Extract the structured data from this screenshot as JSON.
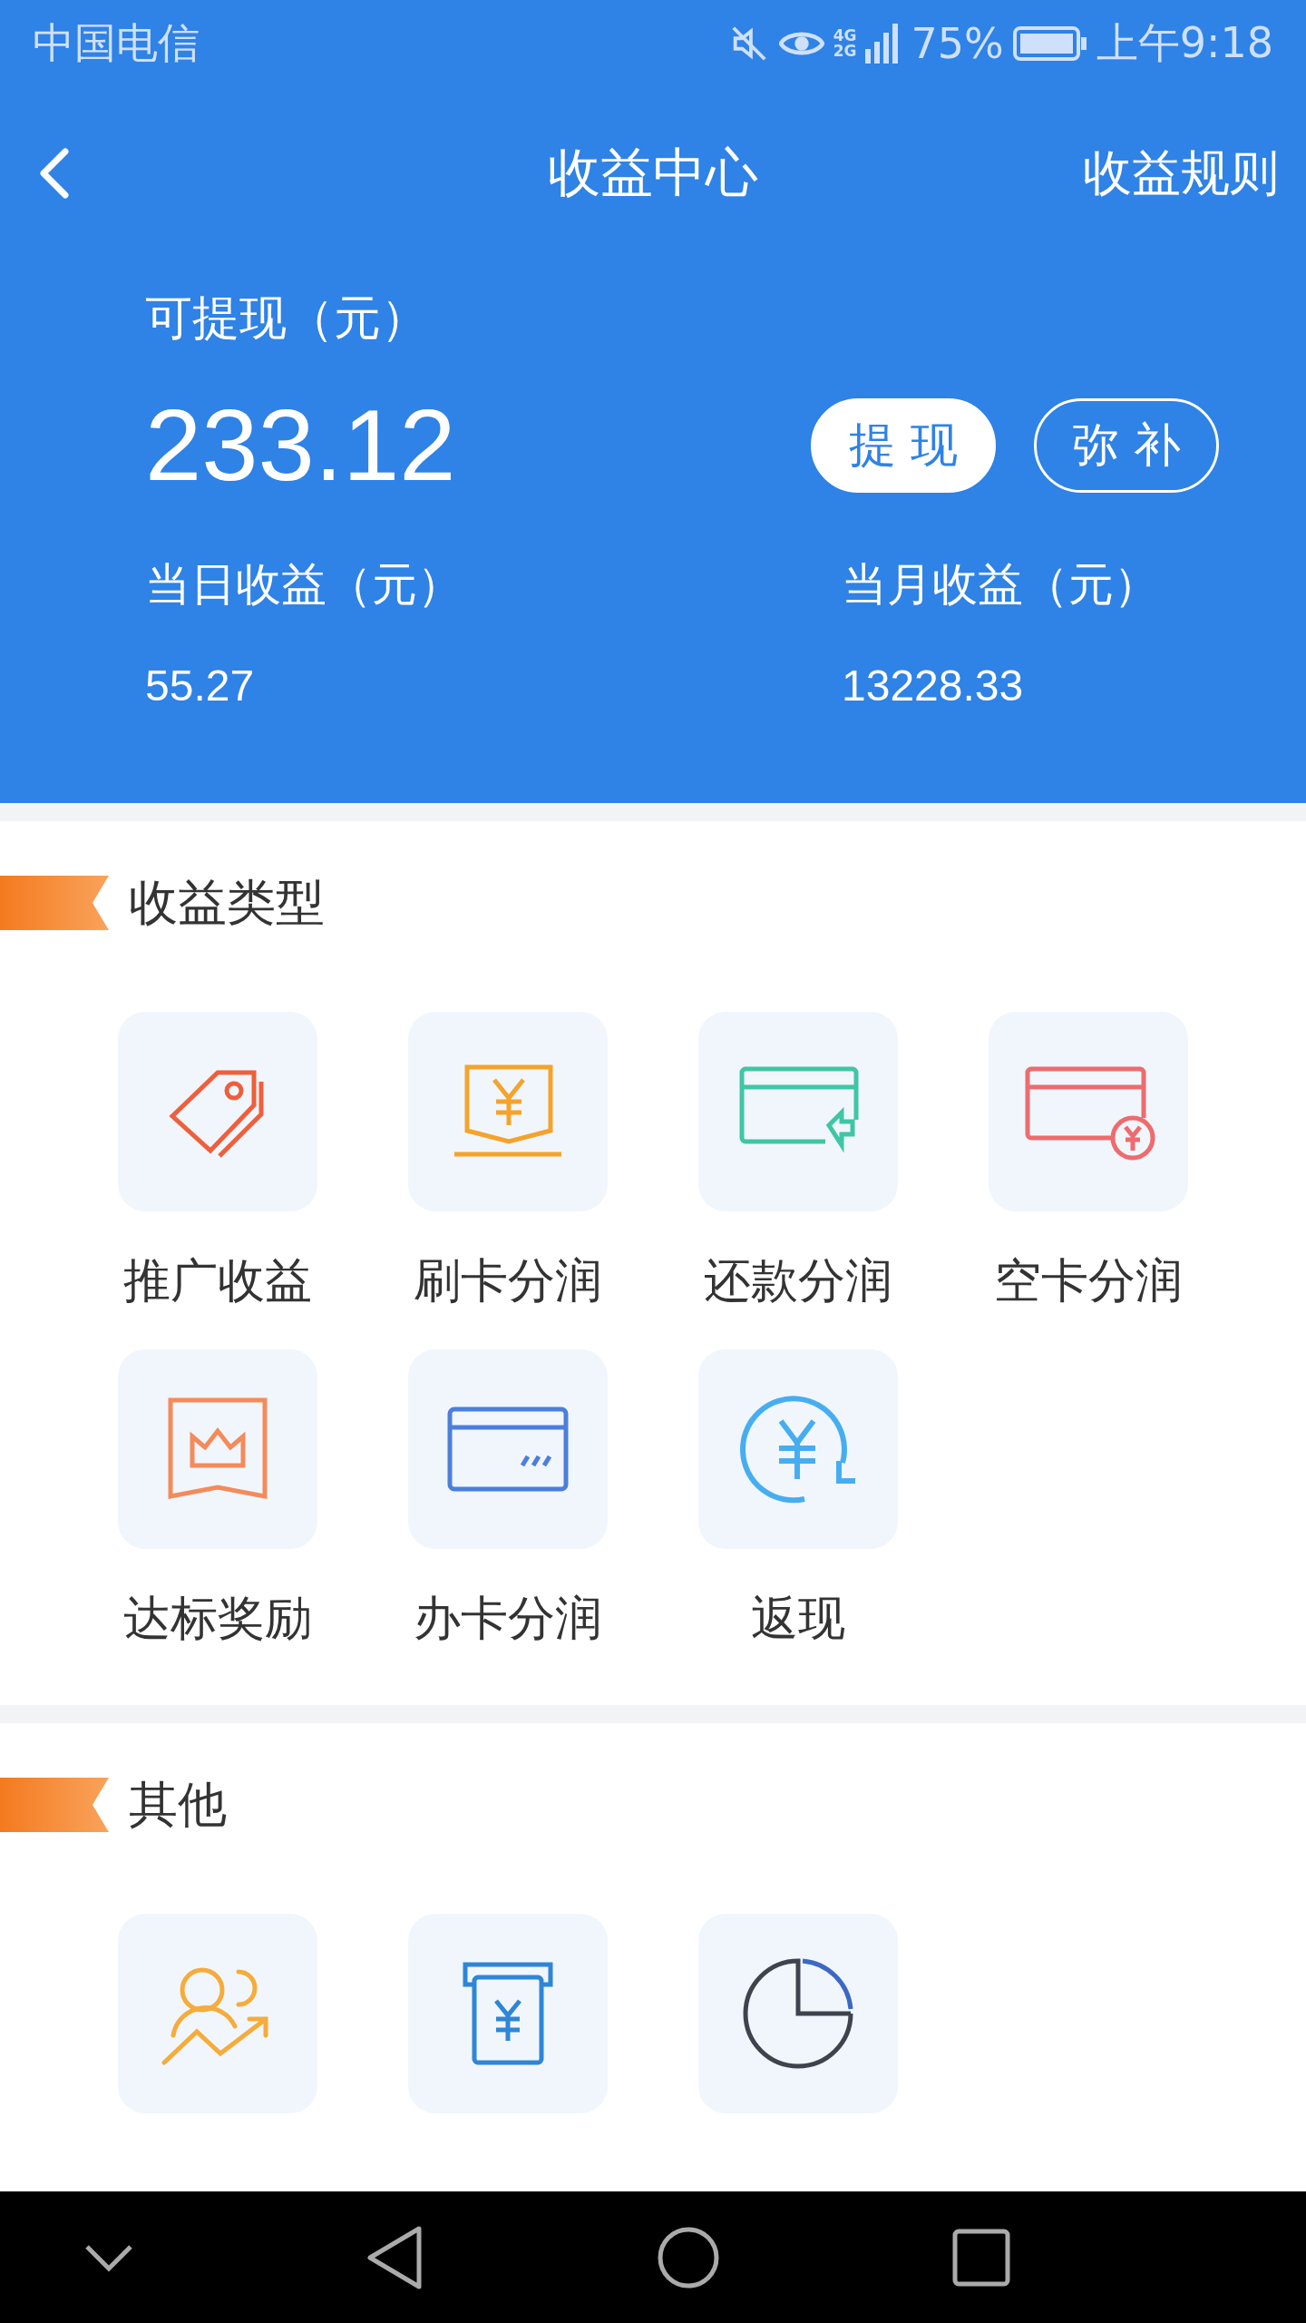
{
  "status_bar": {
    "carrier": "中国电信",
    "network_top": "4G",
    "network_bottom": "2G",
    "battery": "75%",
    "time": "上午9:18"
  },
  "header": {
    "title": "收益中心",
    "rules_link": "收益规则"
  },
  "balance": {
    "label": "可提现（元）",
    "amount": "233.12",
    "buttons": [
      "提 现",
      "弥 补"
    ],
    "stats": [
      {
        "label": "当日收益（元）",
        "value": "55.27"
      },
      {
        "label": "当月收益（元）",
        "value": "13228.33"
      }
    ]
  },
  "sections": [
    {
      "title": "收益类型",
      "items": [
        {
          "kind": "tile",
          "label": "推广收益"
        },
        {
          "kind": "tile",
          "label": "刷卡分润"
        },
        {
          "kind": "tile",
          "label": "还款分润"
        },
        {
          "kind": "tile",
          "label": "空卡分润"
        },
        {
          "kind": "tile",
          "label": "达标奖励"
        },
        {
          "kind": "tile",
          "label": "办卡分润"
        },
        {
          "kind": "tile",
          "label": "返现"
        }
      ]
    },
    {
      "title": "其他",
      "items": [
        {
          "kind": "tile"
        },
        {
          "kind": "tile"
        },
        {
          "kind": "tile"
        }
      ]
    }
  ]
}
